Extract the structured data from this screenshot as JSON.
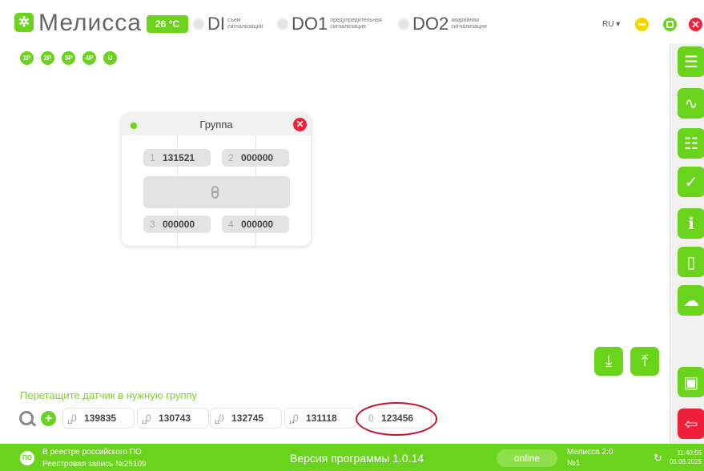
{
  "header": {
    "logo_glyph": "✲",
    "brand": "Мелисса",
    "temperature": "26 °C",
    "signals": [
      {
        "name": "DI",
        "desc": "съем сигнализации"
      },
      {
        "name": "DO1",
        "desc": "предупредительная сигнализация"
      },
      {
        "name": "DO2",
        "desc": "аварийная сигнализация"
      }
    ],
    "language": "RU ▾",
    "close_glyph": "✕"
  },
  "phases": [
    "1P",
    "2P",
    "3P",
    "4P",
    "U"
  ],
  "sidebar": {
    "items": [
      {
        "name": "list-icon",
        "glyph": "☰"
      },
      {
        "name": "chart-icon",
        "glyph": "∿"
      },
      {
        "name": "sliders-icon",
        "glyph": "☷"
      },
      {
        "name": "check-icon",
        "glyph": "✓"
      },
      {
        "name": "info-icon",
        "glyph": "ℹ"
      },
      {
        "name": "document-icon",
        "glyph": "▯"
      },
      {
        "name": "cloud-icon",
        "glyph": "☁"
      },
      {
        "name": "save-icon",
        "glyph": "▣"
      },
      {
        "name": "exit-icon",
        "glyph": "⇦"
      }
    ]
  },
  "group": {
    "title": "Группа",
    "close_glyph": "✕",
    "slots": [
      {
        "num": "1",
        "value": "131521"
      },
      {
        "num": "2",
        "value": "000000"
      },
      {
        "num": "3",
        "value": "000000"
      },
      {
        "num": "4",
        "value": "000000"
      }
    ]
  },
  "actions": {
    "import_glyph": "⤓",
    "export_glyph": "⤒"
  },
  "sensors_area": {
    "hint": "Перетащите датчик в нужную группу",
    "add_glyph": "+",
    "sensors": [
      {
        "sub": "12",
        "zero": "0",
        "value": "139835"
      },
      {
        "sub": "13",
        "zero": "0",
        "value": "130743"
      },
      {
        "sub": "11",
        "zero": "0",
        "value": "132745"
      },
      {
        "sub": "14",
        "zero": "0",
        "value": "131118"
      },
      {
        "sub": "",
        "zero": "0",
        "value": "123456"
      }
    ]
  },
  "footer": {
    "registry_icon": "ПО",
    "registry_line1": "В реестре российского ПО",
    "registry_line2": "Реестровая запись №25109",
    "version": "Версия программы  1.0.14",
    "status": "online",
    "device_name": "Мелисса 2.0",
    "device_number": "№1",
    "sync_glyph": "↻",
    "time": "11:40:55",
    "date": "05.06.2025"
  },
  "colors": {
    "accent": "#6ad31c",
    "danger": "#f0203a",
    "warning": "#f0d800",
    "highlight": "#c8102e"
  }
}
